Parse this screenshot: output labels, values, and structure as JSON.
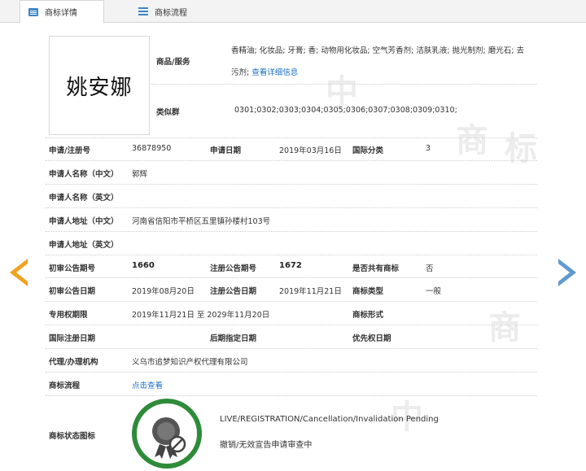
{
  "tabs": [
    {
      "label": "商标详情"
    },
    {
      "label": "商标流程"
    }
  ],
  "watermark_char": "中国商标",
  "logo": {
    "text": "姚安娜"
  },
  "goods": {
    "label": "商品/服务",
    "text": "香精油; 化妆品; 牙膏; 香; 动物用化妆品; 空气芳香剂; 洁肤乳液; 抛光制剂; 磨光石; 去",
    "text2": "污剂;",
    "link": "查看详细信息"
  },
  "similar": {
    "label": "类似群",
    "value": "0301;0302;0303;0304;0305;0306;0307;0308;0309;0310;"
  },
  "fields": {
    "reg_no_label": "申请/注册号",
    "reg_no": "36878950",
    "apply_date_label": "申请日期",
    "apply_date": "2019年03月16日",
    "intl_class_label": "国际分类",
    "intl_class": "3",
    "applicant_cn_label": "申请人名称（中文）",
    "applicant_cn": "郭辉",
    "applicant_en_label": "申请人名称（英文）",
    "address_cn_label": "申请人地址（中文）",
    "address_cn": "河南省信阳市平桥区五里镇孙楼村103号",
    "address_en_label": "申请人地址（英文）",
    "prelim_no_label": "初审公告期号",
    "prelim_no": "1660",
    "reg_pub_no_label": "注册公告期号",
    "reg_pub_no": "1672",
    "shared_label": "是否共有商标",
    "shared": "否",
    "prelim_date_label": "初审公告日期",
    "prelim_date": "2019年08月20日",
    "reg_pub_date_label": "注册公告日期",
    "reg_pub_date": "2019年11月21日",
    "type_label": "商标类型",
    "type": "一般",
    "exclusive_label": "专用权期限",
    "exclusive": "2019年11月21日 至 2029年11月20日",
    "form_label": "商标形式",
    "intl_reg_date_label": "国际注册日期",
    "later_date_label": "后期指定日期",
    "priority_date_label": "优先权日期",
    "agent_label": "代理/办理机构",
    "agent": "义乌市追梦知识产权代理有限公司",
    "flow_label": "商标流程",
    "flow_link": "点击查看",
    "status_icon_label": "商标状态图标",
    "status_en": "LIVE/REGISTRATION/Cancellation/Invalidation Pending",
    "status_cn": "撤销/无效宣告申请审查中"
  },
  "colors": {
    "link": "#1a6fc2",
    "status_green": "#2e8b3a",
    "arrow_left": "#f0a221",
    "arrow_right": "#5f9bd1"
  }
}
